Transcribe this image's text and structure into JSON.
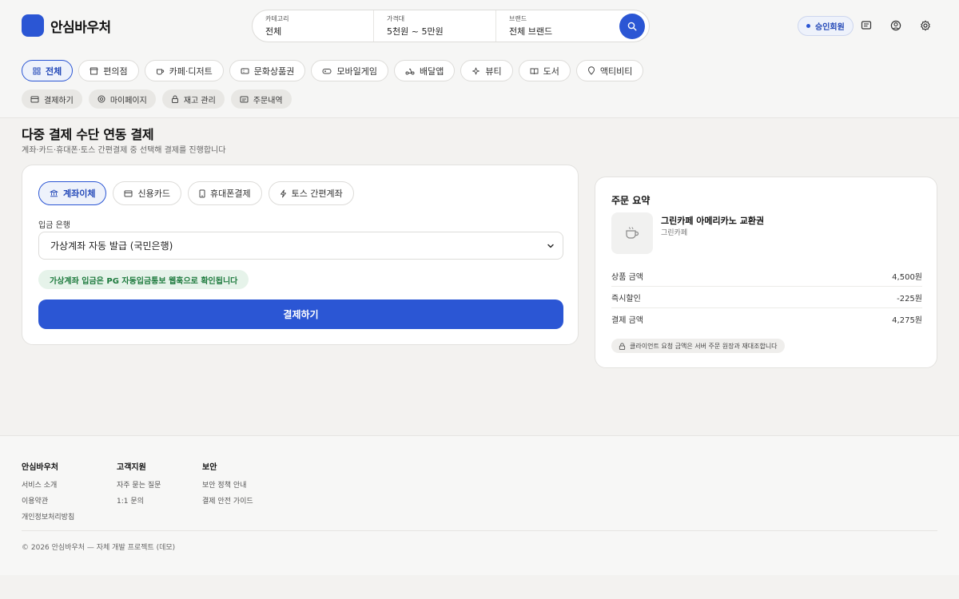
{
  "brand": {
    "name": "안심바우처",
    "accent": "#2b56d4"
  },
  "search": {
    "category_label": "카테고리",
    "category_value": "전체",
    "price_label": "가격대",
    "price_value": "5천원 ~ 5만원",
    "brand_label": "브랜드",
    "brand_value": "전체 브랜드"
  },
  "header": {
    "member_badge": "승인회원"
  },
  "categories": [
    {
      "label": "전체",
      "icon": "grid-icon"
    },
    {
      "label": "편의점",
      "icon": "store-icon"
    },
    {
      "label": "카페·디저트",
      "icon": "cup-icon"
    },
    {
      "label": "문화상품권",
      "icon": "ticket-icon"
    },
    {
      "label": "모바일게임",
      "icon": "gamepad-icon"
    },
    {
      "label": "배달앱",
      "icon": "scooter-icon"
    },
    {
      "label": "뷰티",
      "icon": "sparkle-icon"
    },
    {
      "label": "도서",
      "icon": "book-icon"
    },
    {
      "label": "액티비티",
      "icon": "pin-icon"
    }
  ],
  "subnav": [
    {
      "label": "결제하기",
      "icon": "card-icon"
    },
    {
      "label": "마이페이지",
      "icon": "user-icon"
    },
    {
      "label": "재고 관리",
      "icon": "lock-icon"
    },
    {
      "label": "주문내역",
      "icon": "receipt-icon"
    }
  ],
  "page": {
    "title": "다중 결제 수단 연동 결제",
    "subtitle": "계좌·카드·휴대폰·토스 간편결제 중 선택해 결제를 진행합니다"
  },
  "payment": {
    "tabs": [
      {
        "label": "계좌이체",
        "icon": "bank-icon"
      },
      {
        "label": "신용카드",
        "icon": "card-icon"
      },
      {
        "label": "휴대폰결제",
        "icon": "phone-icon"
      },
      {
        "label": "토스 간편계좌",
        "icon": "bolt-icon"
      }
    ],
    "bank_label": "입금 은행",
    "bank_value": "가상계좌 자동 발급 (국민은행)",
    "notice": "가상계좌 입금은 PG 자동입금통보 웹훅으로 확인됩니다",
    "submit_label": "결제하기"
  },
  "summary": {
    "title": "주문 요약",
    "product_name": "그린카페 아메리카노 교환권",
    "product_brand": "그린카페",
    "rows": [
      {
        "label": "상품 금액",
        "value": "4,500원"
      },
      {
        "label": "즉시할인",
        "value": "-225원"
      },
      {
        "label": "결제 금액",
        "value": "4,275원"
      }
    ],
    "note": "클라이언트 요청 금액은 서버 주문 원장과 재대조합니다"
  },
  "footer": {
    "col1": {
      "title": "안심바우처",
      "links": [
        "서비스 소개",
        "이용약관",
        "개인정보처리방침"
      ]
    },
    "col2": {
      "title": "고객지원",
      "links": [
        "자주 묻는 질문",
        "1:1 문의"
      ]
    },
    "col3": {
      "title": "보안",
      "links": [
        "보안 정책 안내",
        "결제 안전 가이드"
      ]
    },
    "copyright": "© 2026 안심바우처 — 자체 개발 프로젝트 (데모)"
  }
}
